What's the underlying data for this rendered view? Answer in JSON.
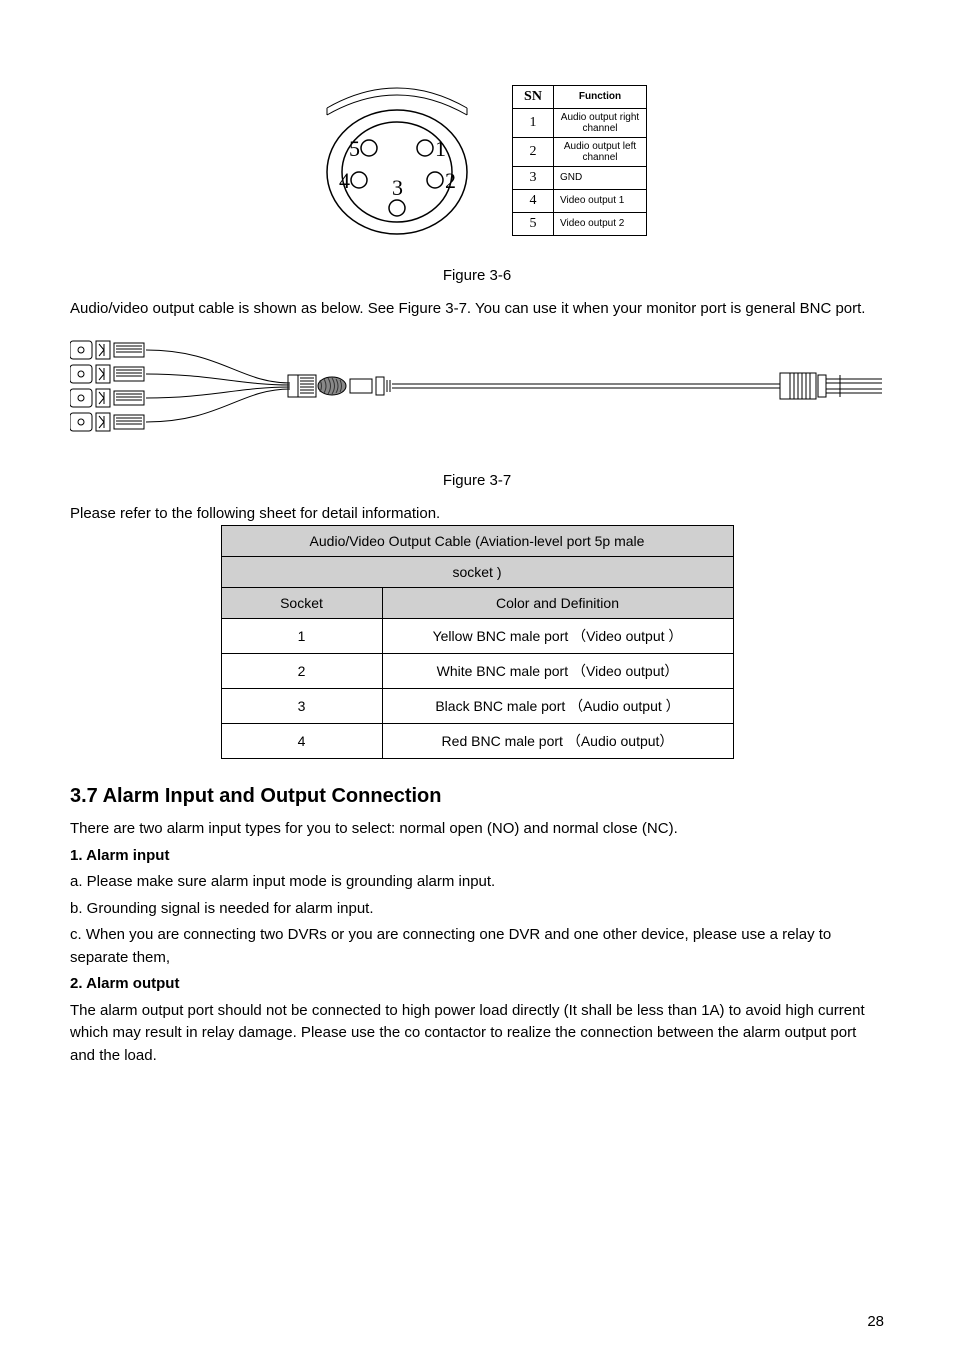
{
  "pin_table": {
    "header_sn": "SN",
    "header_fn": "Function",
    "rows": [
      {
        "sn": "1",
        "fn": "Audio output right channel"
      },
      {
        "sn": "2",
        "fn": "Audio output left  channel"
      },
      {
        "sn": "3",
        "fn": "GND"
      },
      {
        "sn": "4",
        "fn": "Video output 1"
      },
      {
        "sn": "5",
        "fn": "Video output 2"
      }
    ]
  },
  "figcap36": "Figure 3-6",
  "para1": "Audio/video output cable is shown as below. See Figure 3-7. You can use it when your monitor port is general BNC port.",
  "figcap37": "Figure 3-7",
  "para2": "Please refer to the following sheet for detail information.",
  "ref_table": {
    "title1": "Audio/Video Output Cable (Aviation-level port 5p male",
    "title2": "socket )",
    "h_sock": "Socket",
    "h_def": "Color and Definition",
    "rows": [
      {
        "s": "1",
        "d": "Yellow BNC male port （Video output ）"
      },
      {
        "s": "2",
        "d": "White BNC male port （Video output）"
      },
      {
        "s": "3",
        "d": "Black BNC male port （Audio output ）"
      },
      {
        "s": "4",
        "d": "Red BNC male port （Audio output）"
      }
    ]
  },
  "section_heading": "3.7  Alarm Input and Output Connection",
  "body": {
    "l1": "There are two alarm input types for you to select: normal open (NO) and normal close (NC).",
    "l2": "1. Alarm input",
    "l3": "a. Please make sure alarm input mode is grounding alarm input.",
    "l4": "b. Grounding signal is needed for alarm input.",
    "l5": "c. When you are connecting two DVRs or you are connecting one DVR and one other device, please use a relay to separate them,",
    "l6": "2. Alarm output",
    "l7": "The alarm output port should not be connected to high power load directly (It shall be less than 1A) to avoid high current which may result in relay damage. Please use the co contactor to realize the connection between the alarm output port and the load."
  },
  "page_number": "28",
  "pin_labels": {
    "p1": "1",
    "p2": "2",
    "p3": "3",
    "p4": "4",
    "p5": "5"
  }
}
